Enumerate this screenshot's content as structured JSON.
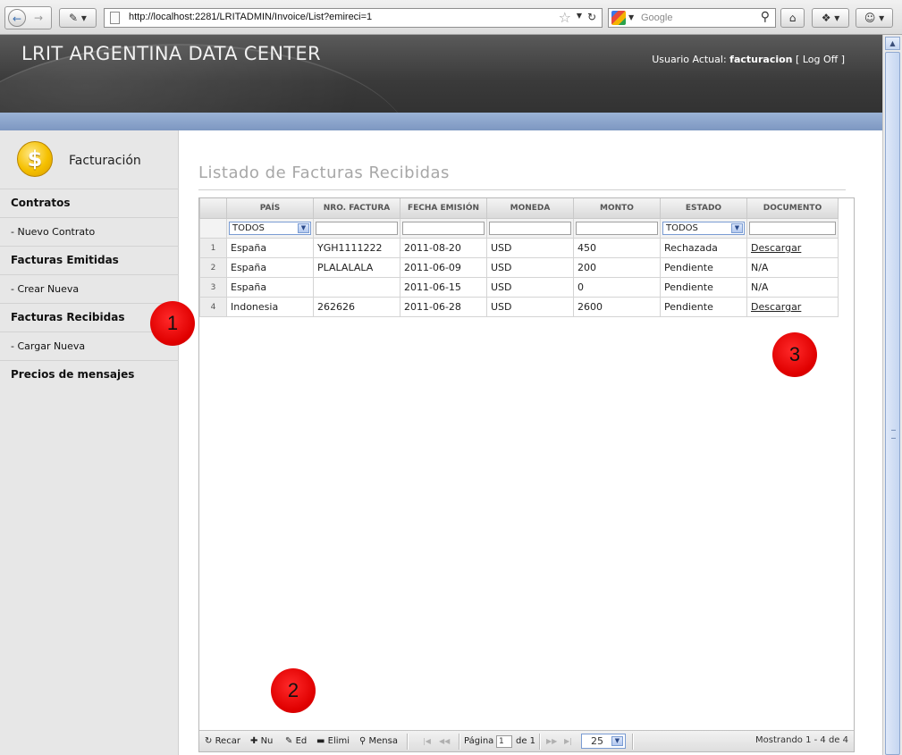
{
  "browser": {
    "url": "http://localhost:2281/LRITADMIN/Invoice/List?emireci=1",
    "search_placeholder": "Google"
  },
  "header": {
    "title": "LRIT ARGENTINA DATA CENTER",
    "user_prefix": "Usuario Actual: ",
    "user_name": "facturacion",
    "logoff_open": " [ ",
    "logoff_label": "Log Off",
    "logoff_close": " ]"
  },
  "sidebar": {
    "module_label": "Facturación",
    "module_icon": "dollar-coin-icon",
    "items": [
      {
        "label": "Contratos",
        "type": "section"
      },
      {
        "label": "- Nuevo Contrato",
        "type": "link"
      },
      {
        "label": "Facturas Emitidas",
        "type": "section"
      },
      {
        "label": "- Crear Nueva",
        "type": "link"
      },
      {
        "label": "Facturas Recibidas",
        "type": "section"
      },
      {
        "label": "- Cargar Nueva",
        "type": "link"
      },
      {
        "label": "Precios de mensajes",
        "type": "section"
      }
    ]
  },
  "main": {
    "title": "Listado de Facturas Recibidas"
  },
  "grid": {
    "columns": [
      "PAÍS",
      "NRO. FACTURA",
      "FECHA EMISIÓN",
      "MONEDA",
      "MONTO",
      "ESTADO",
      "DOCUMENTO"
    ],
    "filters": {
      "pais": "TODOS",
      "estado": "TODOS"
    },
    "rows": [
      {
        "n": "1",
        "pais": "España",
        "nro": "YGH1111222",
        "fecha": "2011-08-20",
        "moneda": "USD",
        "monto": "450",
        "estado": "Rechazada",
        "doc": "Descargar"
      },
      {
        "n": "2",
        "pais": "España",
        "nro": "PLALALALA",
        "fecha": "2011-06-09",
        "moneda": "USD",
        "monto": "200",
        "estado": "Pendiente",
        "doc": "N/A"
      },
      {
        "n": "3",
        "pais": "España",
        "nro": "",
        "fecha": "2011-06-15",
        "moneda": "USD",
        "monto": "0",
        "estado": "Pendiente",
        "doc": "N/A"
      },
      {
        "n": "4",
        "pais": "Indonesia",
        "nro": "262626",
        "fecha": "2011-06-28",
        "moneda": "USD",
        "monto": "2600",
        "estado": "Pendiente",
        "doc": "Descargar"
      }
    ],
    "pager": {
      "buttons": [
        "Recar",
        "Nu",
        "Ed",
        "Elimi",
        "Mensa"
      ],
      "page_label": "Página",
      "page_value": "1",
      "of_label": "de 1",
      "page_size": "25",
      "info": "Mostrando 1 - 4 de 4"
    }
  },
  "annotations": [
    "1",
    "2",
    "3"
  ],
  "colors": {
    "header_bg": "#3a3a3a",
    "accent_bar": "#8aa2c9",
    "sidebar_bg": "#e7e7e7",
    "marker": "#e00000"
  }
}
